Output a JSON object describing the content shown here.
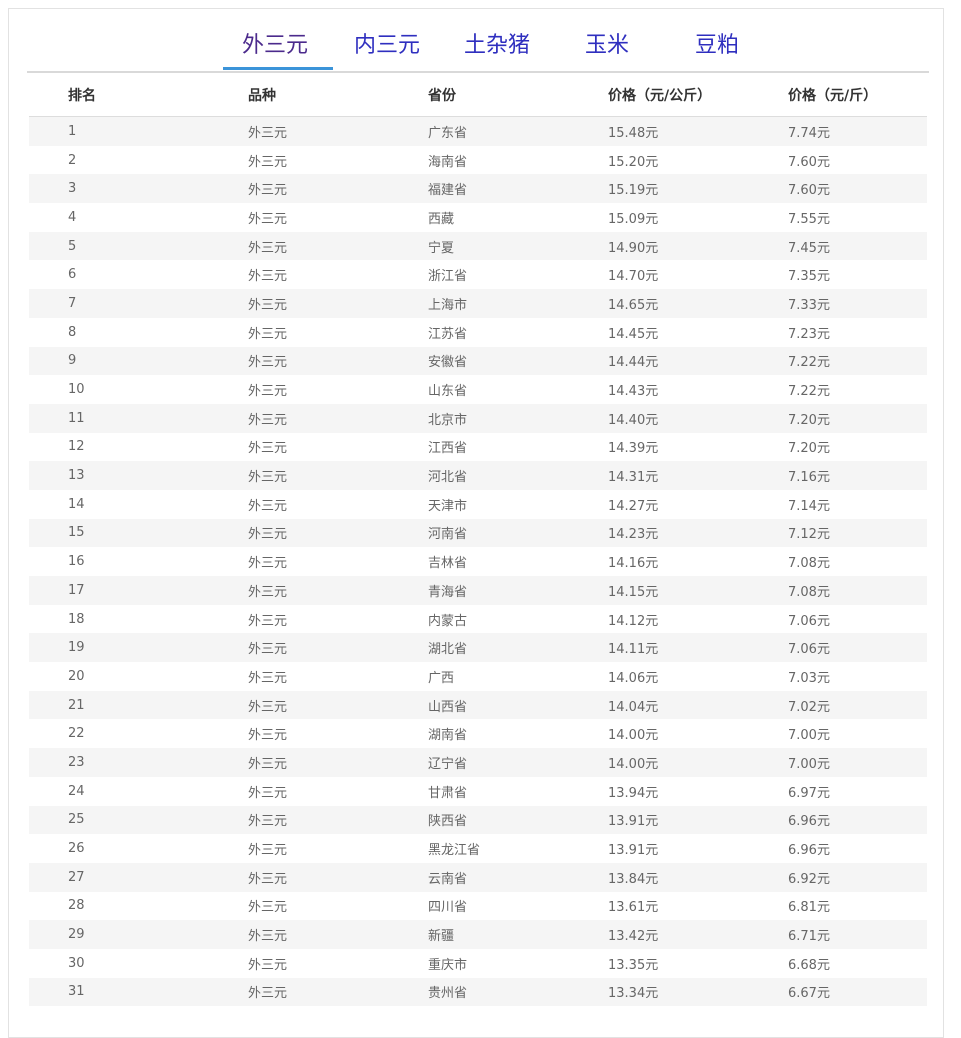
{
  "tabs": [
    {
      "label": "外三元",
      "active": true
    },
    {
      "label": "内三元",
      "active": false
    },
    {
      "label": "土杂猪",
      "active": false
    },
    {
      "label": "玉米",
      "active": false
    },
    {
      "label": "豆粕",
      "active": false
    }
  ],
  "table": {
    "headers": [
      "排名",
      "品种",
      "省份",
      "价格（元/公斤）",
      "价格（元/斤）"
    ],
    "rows": [
      [
        "1",
        "外三元",
        "广东省",
        "15.48元",
        "7.74元"
      ],
      [
        "2",
        "外三元",
        "海南省",
        "15.20元",
        "7.60元"
      ],
      [
        "3",
        "外三元",
        "福建省",
        "15.19元",
        "7.60元"
      ],
      [
        "4",
        "外三元",
        "西藏",
        "15.09元",
        "7.55元"
      ],
      [
        "5",
        "外三元",
        "宁夏",
        "14.90元",
        "7.45元"
      ],
      [
        "6",
        "外三元",
        "浙江省",
        "14.70元",
        "7.35元"
      ],
      [
        "7",
        "外三元",
        "上海市",
        "14.65元",
        "7.33元"
      ],
      [
        "8",
        "外三元",
        "江苏省",
        "14.45元",
        "7.23元"
      ],
      [
        "9",
        "外三元",
        "安徽省",
        "14.44元",
        "7.22元"
      ],
      [
        "10",
        "外三元",
        "山东省",
        "14.43元",
        "7.22元"
      ],
      [
        "11",
        "外三元",
        "北京市",
        "14.40元",
        "7.20元"
      ],
      [
        "12",
        "外三元",
        "江西省",
        "14.39元",
        "7.20元"
      ],
      [
        "13",
        "外三元",
        "河北省",
        "14.31元",
        "7.16元"
      ],
      [
        "14",
        "外三元",
        "天津市",
        "14.27元",
        "7.14元"
      ],
      [
        "15",
        "外三元",
        "河南省",
        "14.23元",
        "7.12元"
      ],
      [
        "16",
        "外三元",
        "吉林省",
        "14.16元",
        "7.08元"
      ],
      [
        "17",
        "外三元",
        "青海省",
        "14.15元",
        "7.08元"
      ],
      [
        "18",
        "外三元",
        "内蒙古",
        "14.12元",
        "7.06元"
      ],
      [
        "19",
        "外三元",
        "湖北省",
        "14.11元",
        "7.06元"
      ],
      [
        "20",
        "外三元",
        "广西",
        "14.06元",
        "7.03元"
      ],
      [
        "21",
        "外三元",
        "山西省",
        "14.04元",
        "7.02元"
      ],
      [
        "22",
        "外三元",
        "湖南省",
        "14.00元",
        "7.00元"
      ],
      [
        "23",
        "外三元",
        "辽宁省",
        "14.00元",
        "7.00元"
      ],
      [
        "24",
        "外三元",
        "甘肃省",
        "13.94元",
        "6.97元"
      ],
      [
        "25",
        "外三元",
        "陕西省",
        "13.91元",
        "6.96元"
      ],
      [
        "26",
        "外三元",
        "黑龙江省",
        "13.91元",
        "6.96元"
      ],
      [
        "27",
        "外三元",
        "云南省",
        "13.84元",
        "6.92元"
      ],
      [
        "28",
        "外三元",
        "四川省",
        "13.61元",
        "6.81元"
      ],
      [
        "29",
        "外三元",
        "新疆",
        "13.42元",
        "6.71元"
      ],
      [
        "30",
        "外三元",
        "重庆市",
        "13.35元",
        "6.68元"
      ],
      [
        "31",
        "外三元",
        "贵州省",
        "13.34元",
        "6.67元"
      ]
    ]
  }
}
